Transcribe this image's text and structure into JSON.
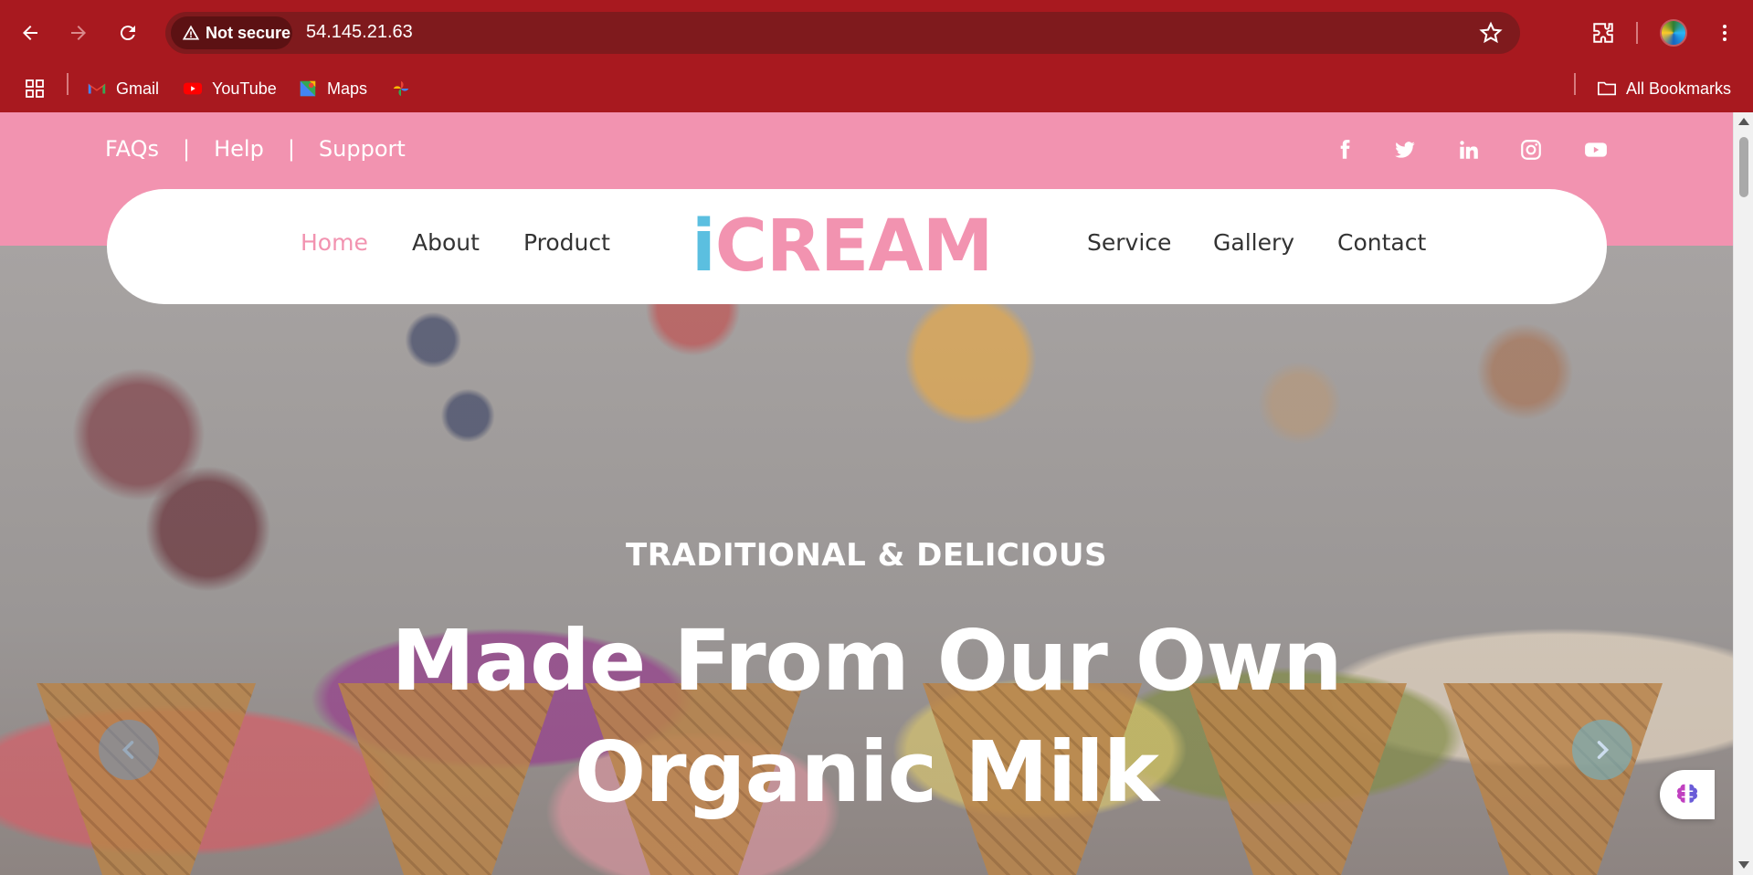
{
  "browser": {
    "security_label": "Not secure",
    "url": "54.145.21.63",
    "bookmarks": [
      {
        "label": "Gmail",
        "icon": "gmail-icon"
      },
      {
        "label": "YouTube",
        "icon": "youtube-icon"
      },
      {
        "label": "Maps",
        "icon": "maps-icon"
      },
      {
        "label": "",
        "icon": "photos-icon"
      }
    ],
    "all_bookmarks_label": "All Bookmarks",
    "accent_color": "#a8191f"
  },
  "topbar": {
    "links": [
      "FAQs",
      "Help",
      "Support"
    ],
    "separator": "|",
    "socials": [
      "facebook-icon",
      "twitter-icon",
      "linkedin-icon",
      "instagram-icon",
      "youtube-icon"
    ],
    "color": "#f293b0"
  },
  "nav": {
    "left": [
      "Home",
      "About",
      "Product"
    ],
    "right": [
      "Service",
      "Gallery",
      "Contact"
    ],
    "active": "Home",
    "logo": {
      "first": "i",
      "rest": "CREAM"
    }
  },
  "hero": {
    "subtitle": "TRADITIONAL & DELICIOUS",
    "title_line1": "Made From Our Own",
    "title_line2": "Organic Milk"
  }
}
